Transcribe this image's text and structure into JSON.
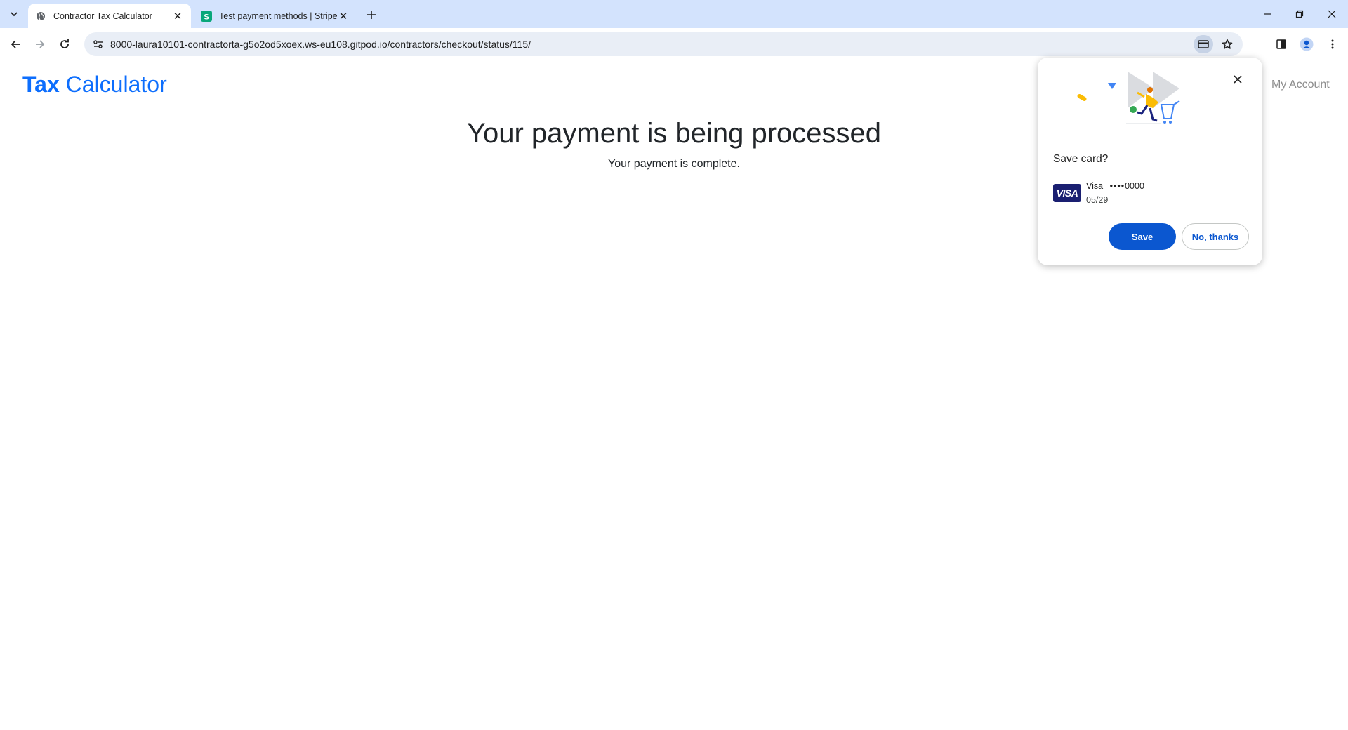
{
  "browser": {
    "tabs": [
      {
        "title": "Contractor Tax Calculator",
        "active": true,
        "favicon": "globe-icon"
      },
      {
        "title": "Test payment methods | Stripe D",
        "active": false,
        "favicon": "stripe-icon",
        "favicon_color": "#09a77a",
        "favicon_letter": "S"
      }
    ],
    "address_url": "8000-laura10101-contractorta-g5o2od5xoex.ws-eu108.gitpod.io/contractors/checkout/status/115/"
  },
  "page": {
    "brand_strong": "Tax",
    "brand_rest": "Calculator",
    "brand_color": "#0d6efd",
    "nav_account": "My Account",
    "heading": "Your payment is being processed",
    "message": "Your payment is complete."
  },
  "save_card_bubble": {
    "title": "Save card?",
    "card_brand_logo": "VISA",
    "card_network": "Visa",
    "card_masked": "••••",
    "card_last4": "0000",
    "card_expiry": "05/29",
    "save_label": "Save",
    "decline_label": "No, thanks",
    "accent_color": "#0b57d0"
  }
}
